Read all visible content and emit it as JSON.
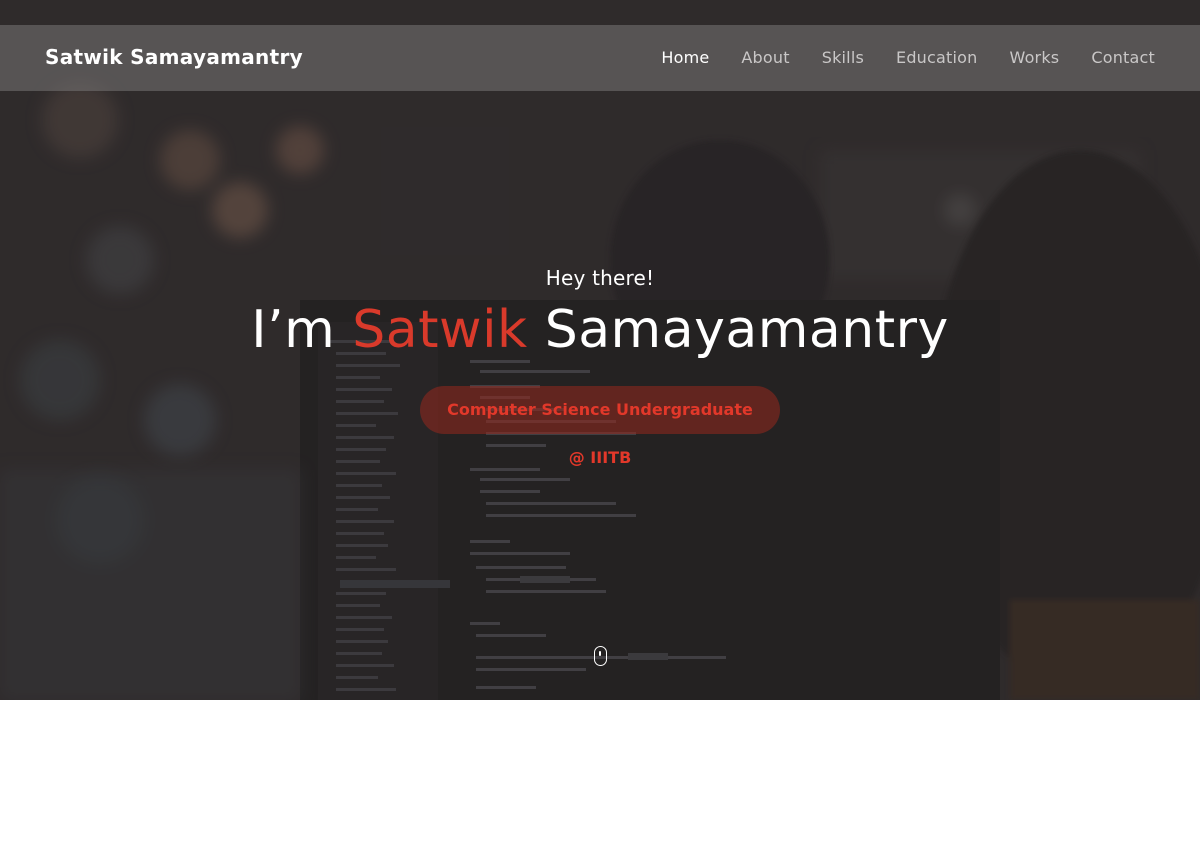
{
  "nav": {
    "brand": "Satwik Samayamantry",
    "links": [
      {
        "label": "Home",
        "active": true
      },
      {
        "label": "About",
        "active": false
      },
      {
        "label": "Skills",
        "active": false
      },
      {
        "label": "Education",
        "active": false
      },
      {
        "label": "Works",
        "active": false
      },
      {
        "label": "Contact",
        "active": false
      }
    ]
  },
  "hero": {
    "greeting": "Hey there!",
    "headline_prefix": "I’m",
    "headline_accent": "Satwik",
    "headline_suffix": "Samayamantry",
    "tagline": "Computer Science Undergraduate @ IIITB",
    "background_image": "person-coding-at-monitor-photo",
    "scroll_icon": "scroll-mouse-icon"
  },
  "colors": {
    "accent": "#d93a2b",
    "nav_text": "#c9c7c7",
    "nav_active": "#ffffff"
  }
}
